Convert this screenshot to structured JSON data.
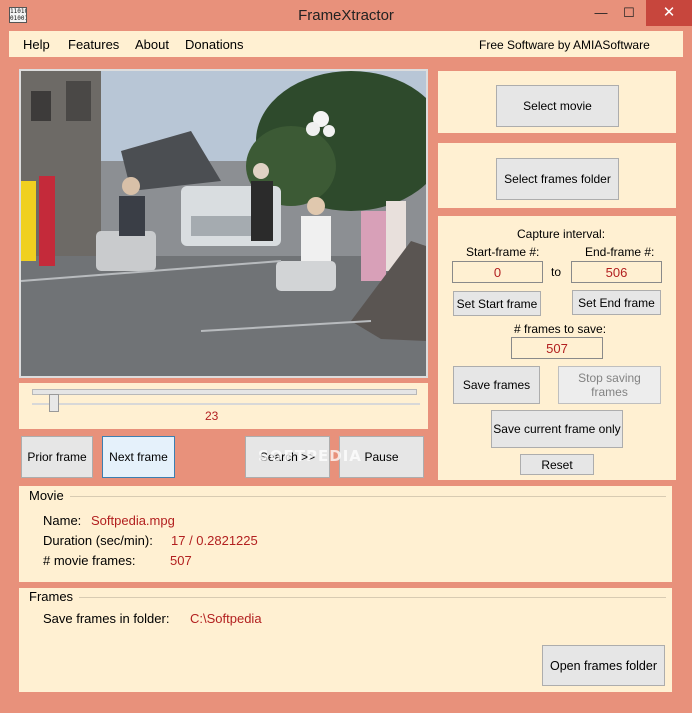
{
  "window": {
    "title": "FrameXtractor",
    "icon_text": "11010\n01001",
    "minimize_glyph": "—",
    "maximize_glyph": "☐",
    "close_glyph": "✕"
  },
  "menu": {
    "items": [
      "Help",
      "Features",
      "About",
      "Donations"
    ],
    "brand": "Free Software by AMIASoftware"
  },
  "slider": {
    "value_label": "23",
    "position_fraction": 0.045
  },
  "playback": {
    "prior_frame": "Prior frame",
    "next_frame": "Next frame",
    "search": "Search >>",
    "pause": "Pause",
    "watermark": "SOFTPEDIA"
  },
  "right": {
    "select_movie": "Select movie",
    "select_frames_folder": "Select frames folder",
    "capture_interval": "Capture interval:",
    "start_frame_label": "Start-frame #:",
    "end_frame_label": "End-frame #:",
    "start_frame_value": "0",
    "end_frame_value": "506",
    "to_label": "to",
    "set_start": "Set Start frame",
    "set_end": "Set End frame",
    "frames_to_save_label": "# frames to save:",
    "frames_to_save_value": "507",
    "save_frames": "Save frames",
    "stop_saving": "Stop saving frames",
    "save_current": "Save current frame only",
    "reset": "Reset"
  },
  "movie": {
    "group_title": "Movie",
    "name_label": "Name:",
    "name_value": "Softpedia.mpg",
    "duration_label": "Duration (sec/min):",
    "duration_value": "17 / 0.2821225",
    "frames_label": "# movie frames:",
    "frames_value": "507"
  },
  "frames": {
    "group_title": "Frames",
    "folder_label": "Save frames in folder:",
    "folder_value": "C:\\Softpedia",
    "open_folder": "Open frames folder"
  }
}
